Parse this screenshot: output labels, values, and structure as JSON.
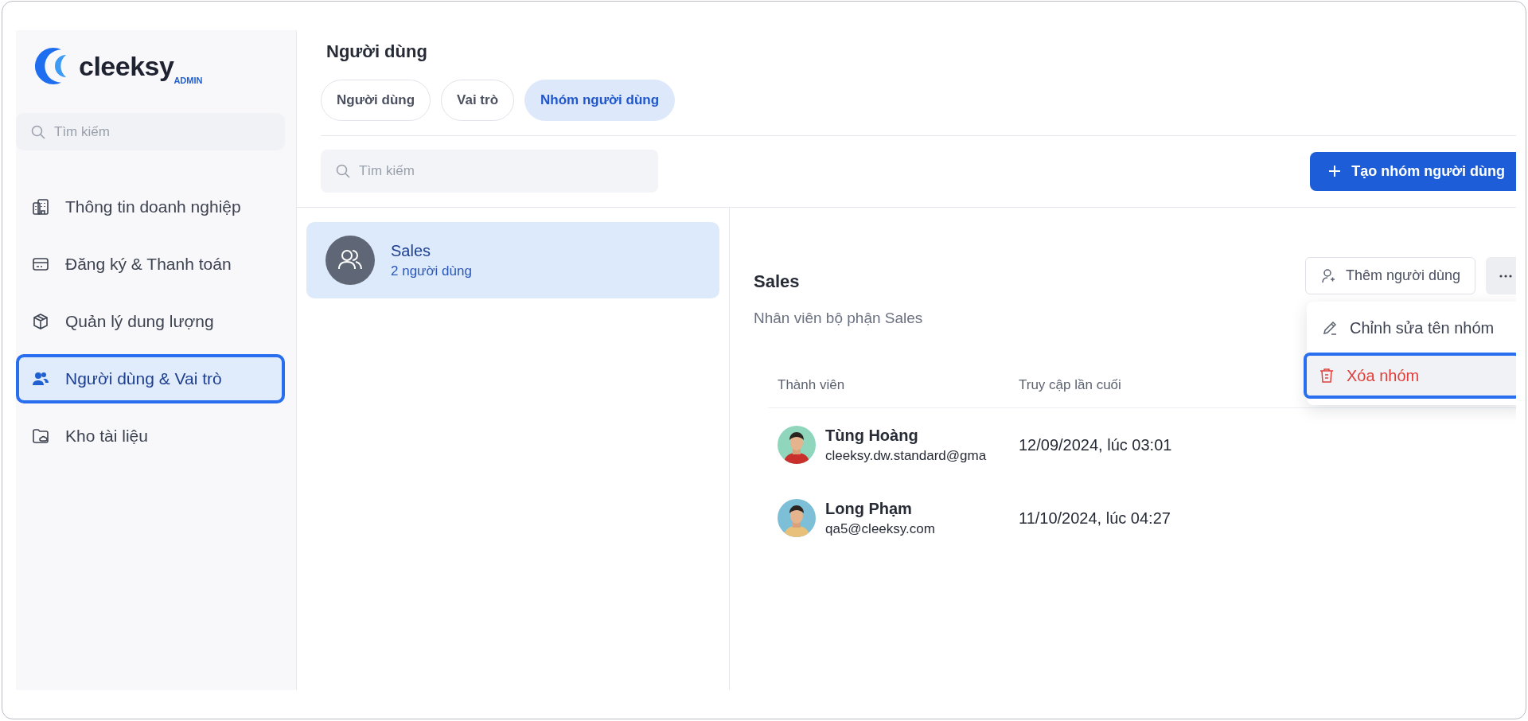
{
  "logo": {
    "name": "cleeksy",
    "badge": "ADMIN"
  },
  "sidebar": {
    "search": {
      "placeholder": "Tìm kiếm"
    },
    "items": [
      {
        "label": "Thông tin doanh nghiệp",
        "kind": "building",
        "selected": false
      },
      {
        "label": "Đăng ký & Thanh toán",
        "kind": "card",
        "selected": false
      },
      {
        "label": "Quản lý dung lượng",
        "kind": "box",
        "selected": false
      },
      {
        "label": "Người dùng & Vai trò",
        "kind": "users",
        "selected": true
      },
      {
        "label": "Kho tài liệu",
        "kind": "folder",
        "selected": false
      }
    ]
  },
  "page": {
    "title": "Người dùng",
    "tabs": [
      {
        "label": "Người dùng",
        "selected": false
      },
      {
        "label": "Vai trò",
        "selected": false
      },
      {
        "label": "Nhóm người dùng",
        "selected": true
      }
    ],
    "search": {
      "placeholder": "Tìm kiếm"
    },
    "create_button": "Tạo nhóm người dùng"
  },
  "groups": [
    {
      "name": "Sales",
      "count": "2 người dùng",
      "selected": true
    }
  ],
  "detail": {
    "title": "Sales",
    "description": "Nhân viên bộ phận Sales",
    "add_button": "Thêm người dùng",
    "menu": [
      {
        "label": "Chỉnh sửa tên nhóm",
        "kind": "edit",
        "highlighted": false
      },
      {
        "label": "Xóa nhóm",
        "kind": "delete",
        "highlighted": true
      }
    ],
    "columns": [
      "Thành viên",
      "Truy cập lần cuối"
    ],
    "members": [
      {
        "name": "Tùng Hoàng",
        "email": "cleeksy.dw.standard@gma",
        "last_access": "12/09/2024, lúc 03:01",
        "color": "#8fd6bd"
      },
      {
        "name": "Long Phạm",
        "email": "qa5@cleeksy.com",
        "last_access": "11/10/2024, lúc 04:27",
        "color": "#7cbfd6"
      }
    ]
  }
}
